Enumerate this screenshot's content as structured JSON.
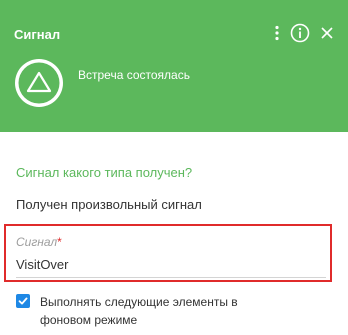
{
  "panel": {
    "title": "Сигнал",
    "element_caption": "Встреча состоялась",
    "header_color": "#5cb85c"
  },
  "header_actions": {
    "more_icon": "vertical-dots-icon",
    "info_icon": "info-circle-icon",
    "close_icon": "close-icon"
  },
  "element_icon": "triangle-signal-icon",
  "question": "Сигнал какого типа получен?",
  "answer": "Получен произвольный сигнал",
  "signal_field": {
    "label": "Сигнал",
    "required_mark": "*",
    "value": "VisitOver",
    "highlight_color": "#e02b2b"
  },
  "background_option": {
    "checked": true,
    "label": "Выполнять следующие элементы в фоновом режиме",
    "accent": "#1e88e5"
  }
}
